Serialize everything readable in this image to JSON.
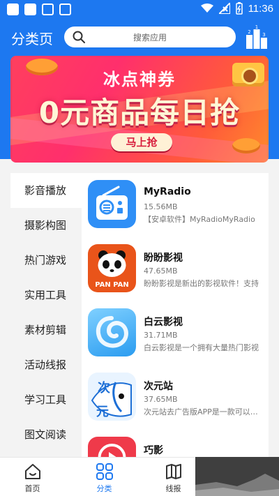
{
  "status_bar": {
    "time": "11:36"
  },
  "header": {
    "title": "分类页",
    "search_placeholder": "搜索应用"
  },
  "banner": {
    "top_label": "冰点神券",
    "headline": "0元商品每日抢",
    "button": "马上抢"
  },
  "categories": [
    {
      "label": "影音播放",
      "active": true
    },
    {
      "label": "摄影构图"
    },
    {
      "label": "热门游戏"
    },
    {
      "label": "实用工具"
    },
    {
      "label": "素材剪辑"
    },
    {
      "label": "活动线报"
    },
    {
      "label": "学习工具"
    },
    {
      "label": "图文阅读"
    }
  ],
  "apps": [
    {
      "name": "MyRadio",
      "size": "15.56MB",
      "desc": "【安卓软件】MyRadioMyRadio",
      "icon": "radio-icon"
    },
    {
      "name": "盼盼影视",
      "size": "47.65MB",
      "desc": "盼盼影视是新出的影视软件！支持",
      "icon": "panda-icon"
    },
    {
      "name": "白云影视",
      "size": "31.71MB",
      "desc": "白云影视是一个拥有大量热门影视",
      "icon": "cloud-icon"
    },
    {
      "name": "次元站",
      "size": "37.65MB",
      "desc": "次元站去广告版APP是一款可以观看",
      "icon": "anime-icon"
    },
    {
      "name": "巧影",
      "size": "",
      "desc": "",
      "icon": "kinemaster-icon"
    }
  ],
  "bottom_nav": [
    {
      "label": "首页",
      "icon": "home-icon"
    },
    {
      "label": "分类",
      "icon": "grid-icon",
      "active": true
    },
    {
      "label": "线报",
      "icon": "map-icon"
    }
  ],
  "colors": {
    "primary": "#1d78f0",
    "banner": "#ff3f5e"
  }
}
